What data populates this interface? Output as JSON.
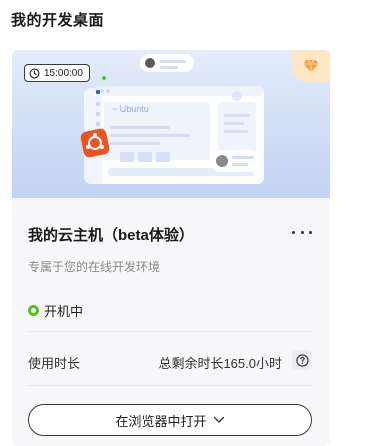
{
  "page": {
    "title": "我的开发桌面"
  },
  "card": {
    "timer": "15:00:00",
    "name": "我的云主机（beta体验）",
    "description": "专属于您的在线开发环境",
    "status": {
      "label": "开机中",
      "color": "#52c41a"
    },
    "usage": {
      "label": "使用时长",
      "value": "总剩余时长165.0小时"
    },
    "open_button": "在浏览器中打开",
    "illustration": {
      "window_text": "~ Ubuntu"
    }
  },
  "colors": {
    "accent": "#52c41a",
    "vip": "#f7a23b",
    "ubuntu": "#e95420"
  },
  "icons": [
    "clock-icon",
    "gem-icon",
    "more-icon",
    "help-icon",
    "chevron-down-icon",
    "ubuntu-icon"
  ]
}
